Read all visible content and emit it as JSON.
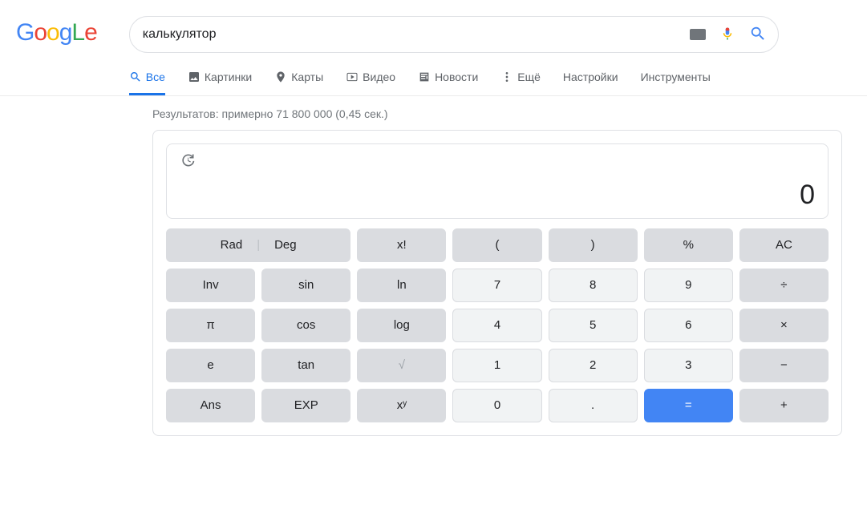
{
  "search": {
    "query": "калькулятор",
    "tabs": {
      "all": "Все",
      "images": "Картинки",
      "maps": "Карты",
      "videos": "Видео",
      "news": "Новости",
      "more": "Ещё",
      "settings": "Настройки",
      "tools": "Инструменты"
    }
  },
  "results": {
    "stats": "Результатов: примерно 71 800 000 (0,45 сек.)"
  },
  "calculator": {
    "display": "0",
    "buttons": {
      "rad": "Rad",
      "deg": "Deg",
      "factorial": "x!",
      "lparen": "(",
      "rparen": ")",
      "percent": "%",
      "ac": "AC",
      "inv": "Inv",
      "sin": "sin",
      "ln": "ln",
      "n7": "7",
      "n8": "8",
      "n9": "9",
      "divide": "÷",
      "pi": "π",
      "cos": "cos",
      "log": "log",
      "n4": "4",
      "n5": "5",
      "n6": "6",
      "multiply": "×",
      "e": "e",
      "tan": "tan",
      "sqrt": "√",
      "n1": "1",
      "n2": "2",
      "n3": "3",
      "minus": "−",
      "ans": "Ans",
      "exp": "EXP",
      "pow": "xʸ",
      "n0": "0",
      "dot": ".",
      "equals": "=",
      "plus": "+"
    }
  }
}
